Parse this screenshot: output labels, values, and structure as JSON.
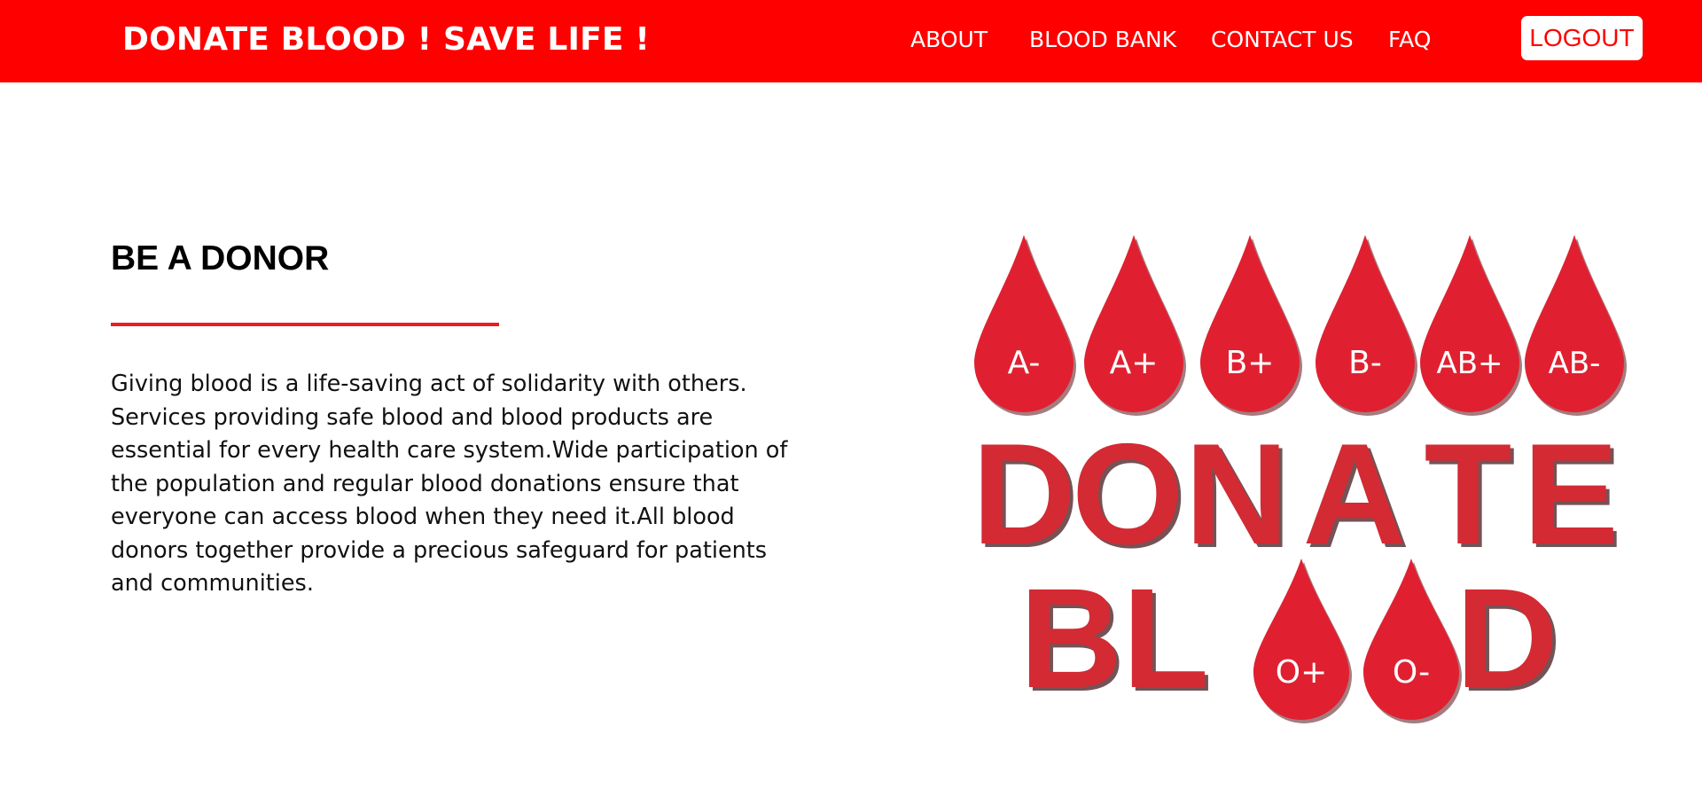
{
  "header": {
    "brand": "DONATE BLOOD ! SAVE LIFE !",
    "nav": {
      "about": "ABOUT",
      "blood_bank": "BLOOD BANK",
      "contact_us": "CONTACT US",
      "faq": "FAQ"
    },
    "logout_label": "LOGOUT"
  },
  "main": {
    "heading": "BE A DONOR",
    "paragraph": "Giving blood is a life-saving act of solidarity with others. Services providing safe blood and blood products are essential for every health care system.Wide participation of the population and regular blood donations ensure that everyone can access blood when they need it.All blood donors together provide a precious safeguard for patients and communities."
  },
  "illustration": {
    "drops_top": [
      "A-",
      "A+",
      "B+",
      "B-",
      "AB+",
      "AB-"
    ],
    "word_donate": [
      "D",
      "O",
      "N",
      "A",
      "T",
      "E"
    ],
    "word_blood_start": [
      "B",
      "L"
    ],
    "drops_bottom": [
      "O+",
      "O-"
    ],
    "word_blood_end": [
      "D"
    ]
  },
  "colors": {
    "brand_red": "#fe0000",
    "divider_red": "#ed1c24",
    "drop_red": "#e02030",
    "letter_red": "#d42a33"
  }
}
